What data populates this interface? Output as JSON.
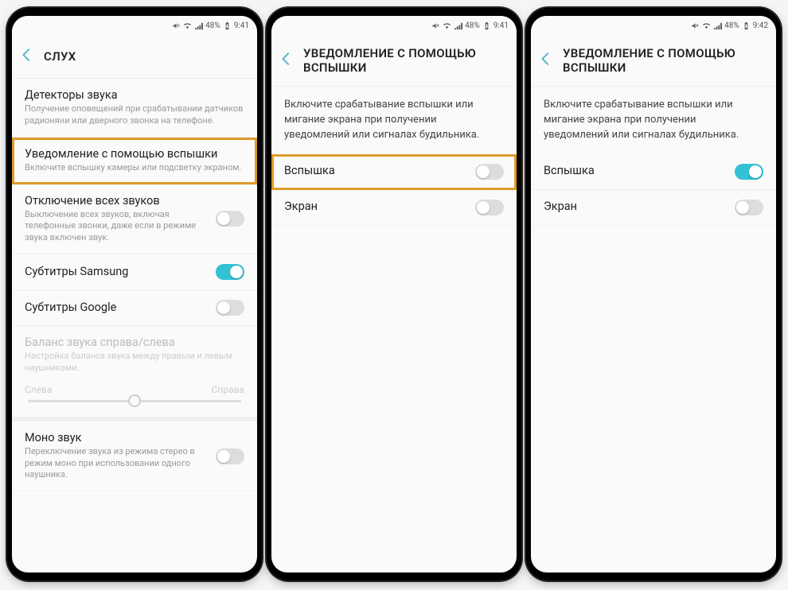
{
  "status": {
    "battery": "48%",
    "time1": "9:41",
    "time2": "9:41",
    "time3": "9:42"
  },
  "phone1": {
    "header": "СЛУХ",
    "items": [
      {
        "title": "Детекторы звука",
        "sub": "Получение оповещений при срабатывании датчиков радионяни или дверного звонка на телефоне."
      },
      {
        "title": "Уведомление с помощью вспышки",
        "sub": "Включите вспышку камеры или подсветку экраном."
      },
      {
        "title": "Отключение всех звуков",
        "sub": "Выключение всех звуков, включая телефонные звонки, даже если в режиме звука включен звук."
      },
      {
        "title": "Субтитры Samsung"
      },
      {
        "title": "Субтитры Google"
      },
      {
        "title": "Баланс звука справа/слева",
        "sub": "Настройка баланса звука между правым и левым наушниками."
      },
      {
        "left": "Слева",
        "right": "Справа"
      },
      {
        "title": "Моно звук",
        "sub": "Переключение звука из режима стерео в режим моно при использовании одного наушника."
      }
    ]
  },
  "phone2": {
    "header": "УВЕДОМЛЕНИЕ С ПОМОЩЬЮ ВСПЫШКИ",
    "desc": "Включите срабатывание вспышки или мигание экрана при получении уведомлений или сигналах будильника.",
    "flash": "Вспышка",
    "screen": "Экран"
  },
  "phone3": {
    "header": "УВЕДОМЛЕНИЕ С ПОМОЩЬЮ ВСПЫШКИ",
    "desc": "Включите срабатывание вспышки или мигание экрана при получении уведомлений или сигналах будильника.",
    "flash": "Вспышка",
    "screen": "Экран"
  }
}
